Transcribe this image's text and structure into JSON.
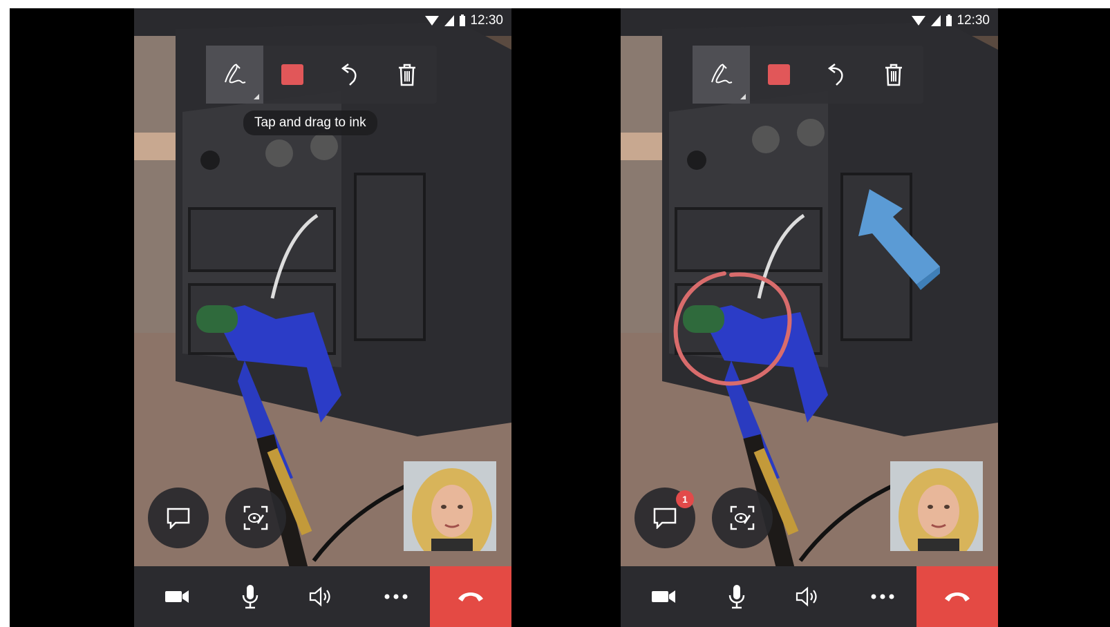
{
  "status_bar": {
    "time": "12:30"
  },
  "ink_toolbar": {
    "pen_icon": "pen-ink-icon",
    "color_icon": "color-swatch-icon",
    "undo_icon": "undo-icon",
    "delete_icon": "trash-icon",
    "selected_color": "#e15759"
  },
  "left_panel": {
    "tooltip": "Tap and drag to ink"
  },
  "right_panel": {
    "chat_badge": "1"
  },
  "call_controls": {
    "icons": [
      "video-camera-icon",
      "microphone-icon",
      "speaker-icon",
      "more-icon",
      "hang-up-icon"
    ],
    "hangup_color": "#e44a44"
  },
  "annotation_colors": {
    "circle": "#d96c6c",
    "arrow": "#5b9bd5"
  }
}
